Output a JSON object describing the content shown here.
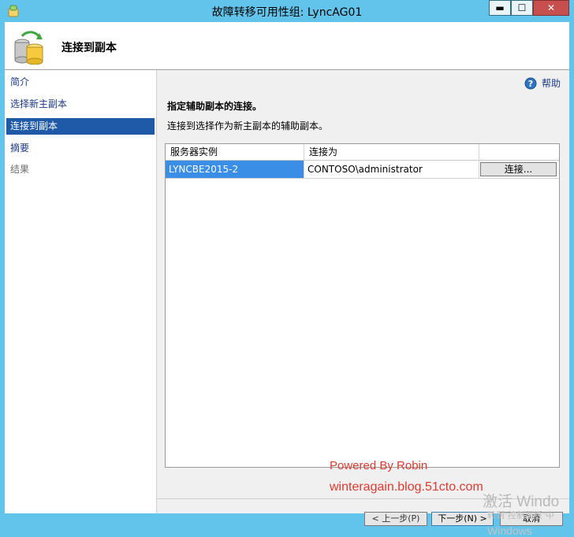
{
  "window": {
    "title": "故障转移可用性组: LyncAG01",
    "controls": {
      "minimize": "▬",
      "maximize": "☐",
      "close": "✕"
    }
  },
  "header": {
    "page_title": "连接到副本",
    "icon": "database-refresh-icon"
  },
  "sidebar": {
    "items": [
      {
        "label": "简介",
        "state": "normal"
      },
      {
        "label": "选择新主副本",
        "state": "normal"
      },
      {
        "label": "连接到副本",
        "state": "selected"
      },
      {
        "label": "摘要",
        "state": "normal"
      },
      {
        "label": "结果",
        "state": "disabled"
      }
    ]
  },
  "main": {
    "help_label": "帮助",
    "section_title": "指定辅助副本的连接。",
    "section_desc": "连接到选择作为新主副本的辅助副本。",
    "table": {
      "columns": [
        "服务器实例",
        "连接为",
        ""
      ],
      "rows": [
        {
          "instance": "LYNCBE2015-2",
          "connect_as": "CONTOSO\\administrator",
          "button": "连接..."
        }
      ]
    }
  },
  "footer": {
    "prev": "< 上一步(P)",
    "next": "下一步(N) >",
    "cancel": "取消"
  },
  "overlay": {
    "watermark_line1": "Powered By Robin",
    "watermark_line2": "winteragain.blog.51cto.com",
    "activate_line1": "激活 Windo",
    "activate_line2": "转到\"控制面板\"中",
    "activate_line3": "Windows"
  },
  "colors": {
    "titlebar": "#62c4ea",
    "nav_selected": "#1e5aa8",
    "row_selected": "#3a8ee6",
    "link": "#1c3a8b",
    "watermark": "#e03a2e"
  }
}
